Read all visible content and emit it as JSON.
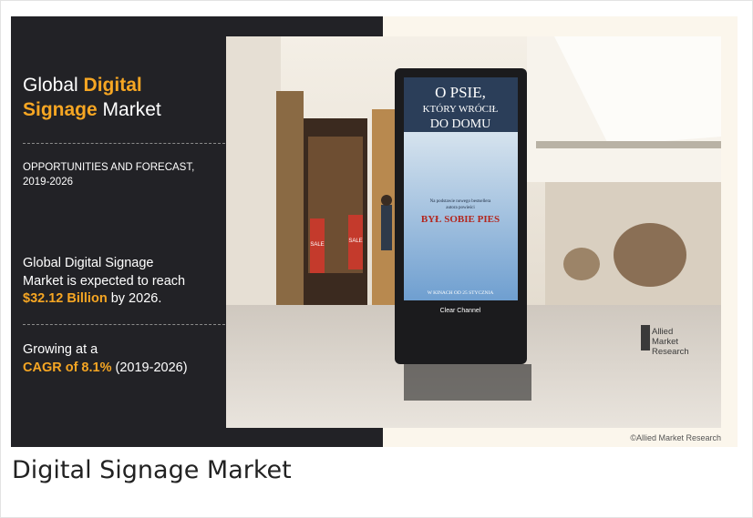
{
  "banner": {
    "title_line1_prefix": "Global",
    "title_line1_accent": "Digital",
    "title_line2_accent": "Signage",
    "title_line2_suffix": "Market",
    "subtitle_line1": "OPPORTUNITIES AND FORECAST,",
    "subtitle_line2": "2019-2026",
    "reach_line1": "Global Digital Signage",
    "reach_line2": "Market is expected to reach",
    "reach_value": "$32.12 Billion",
    "reach_suffix": "by 2026.",
    "cagr_line1": "Growing at a",
    "cagr_value": "CAGR of 8.1%",
    "cagr_period": "(2019-2026)",
    "copyright": "©Allied Market Research"
  },
  "photo": {
    "kiosk_headline_line1": "O PSIE,",
    "kiosk_headline_line2": "KTÓRY WRÓCIŁ",
    "kiosk_headline_line3": "DO DOMU",
    "kiosk_small_line1": "Na podstawie nowego bestsellera",
    "kiosk_small_line2": "autora powieści",
    "kiosk_book_title": "BYŁ SOBIE PIES",
    "kiosk_release": "W KINACH OD 25 STYCZNIA",
    "kiosk_brand": "Clear Channel",
    "sale_sign": "SALE",
    "logo_line1": "Allied",
    "logo_line2": "Market",
    "logo_line3": "Research"
  },
  "caption": "Digital Signage Market",
  "colors": {
    "accent": "#f6a623",
    "panel": "#222226"
  }
}
